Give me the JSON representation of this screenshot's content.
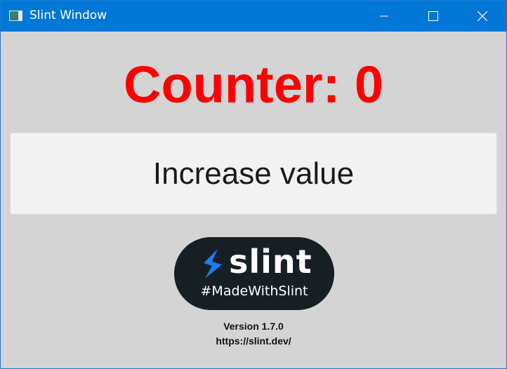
{
  "window": {
    "title": "Slint Window",
    "accent": "#0078d7"
  },
  "counter": {
    "label": "Counter: 0",
    "color": "#ff0000"
  },
  "button": {
    "label": "Increase value"
  },
  "badge": {
    "logo_text": "slint",
    "tagline": "#MadeWithSlint"
  },
  "footer": {
    "version": "Version 1.7.0",
    "url": "https://slint.dev/"
  }
}
